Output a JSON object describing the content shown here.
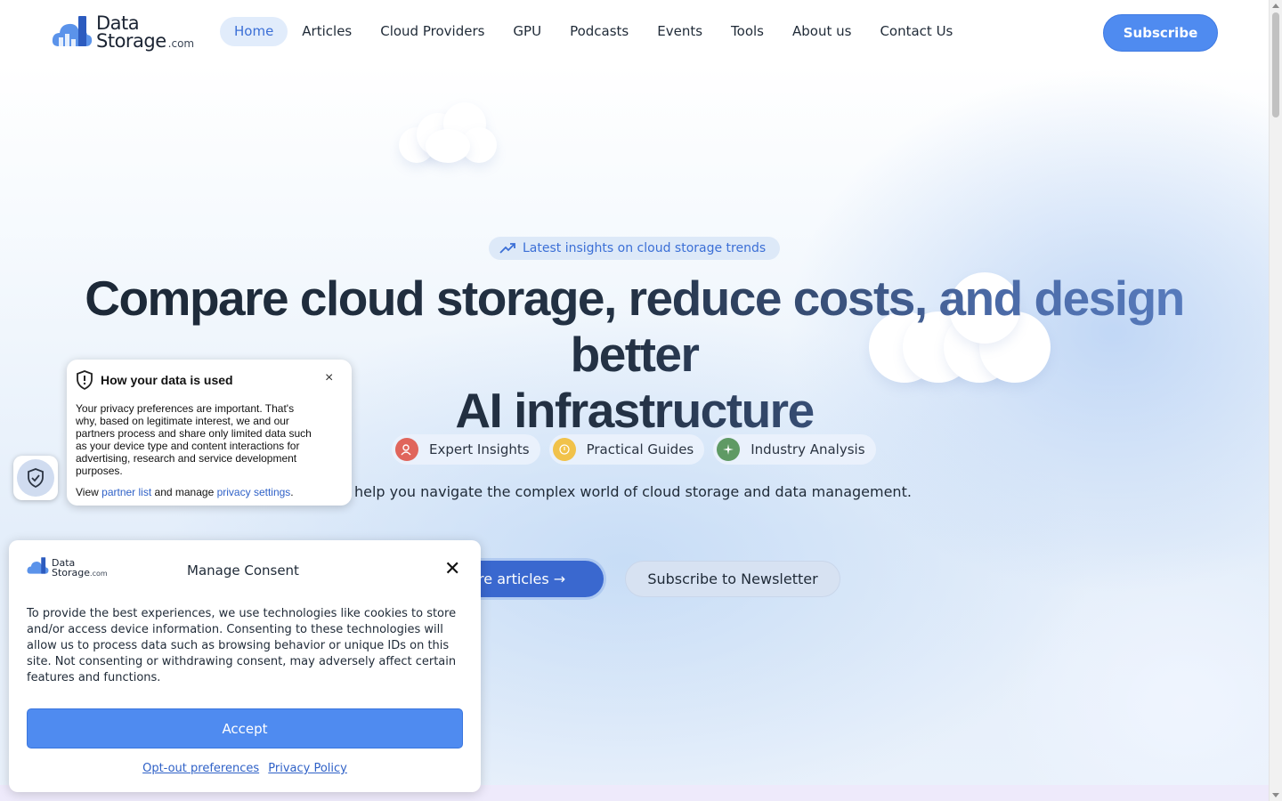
{
  "header": {
    "logo": {
      "line1": "Data",
      "line2": "Storage",
      "suffix": ".com"
    },
    "nav": [
      {
        "label": "Home",
        "active": true
      },
      {
        "label": "Articles"
      },
      {
        "label": "Cloud Providers"
      },
      {
        "label": "GPU"
      },
      {
        "label": "Podcasts"
      },
      {
        "label": "Events"
      },
      {
        "label": "Tools"
      },
      {
        "label": "About us"
      },
      {
        "label": "Contact Us"
      }
    ],
    "subscribe_label": "Subscribe"
  },
  "hero": {
    "badge": "Latest insights on cloud storage trends",
    "headline_line1": "Compare cloud storage, reduce costs, and design better",
    "headline_line2": "AI infrastructure",
    "pills": [
      {
        "label": "Expert Insights",
        "icon": "user-star-icon",
        "color": "#e0655b"
      },
      {
        "label": "Practical Guides",
        "icon": "lightbulb-icon",
        "color": "#f1c24a"
      },
      {
        "label": "Industry Analysis",
        "icon": "sparkle-icon",
        "color": "#5f9a64"
      }
    ],
    "tagline": "help you navigate the complex world of cloud storage and data management.",
    "primary_button": "lore articles →",
    "secondary_button": "Subscribe to Newsletter"
  },
  "privacy_popup": {
    "title": "How your data is used",
    "body": "Your privacy preferences are important. That's why, based on legitimate interest, we and our partners process and share only limited data such as your device type and content interactions for advertising, research and service development purposes.",
    "view_text": "View",
    "partner_link": "partner list",
    "and_manage": "and manage",
    "settings_link": "privacy settings",
    "period": ".",
    "close": "×"
  },
  "consent": {
    "logo_line1": "Data",
    "logo_line2": "Storage",
    "logo_suffix": ".com",
    "title": "Manage Consent",
    "close": "✕",
    "body": "To provide the best experiences, we use technologies like cookies to store and/or access device information. Consenting to these technologies will allow us to process data such as browsing behavior or unique IDs on this site. Not consenting or withdrawing consent, may adversely affect certain features and functions.",
    "accept": "Accept",
    "opt_out": "Opt-out preferences",
    "privacy_policy": "Privacy Policy"
  },
  "colors": {
    "accent": "#4f8bf0",
    "primary_dark": "#3a68cf",
    "link": "#2f61c7"
  }
}
